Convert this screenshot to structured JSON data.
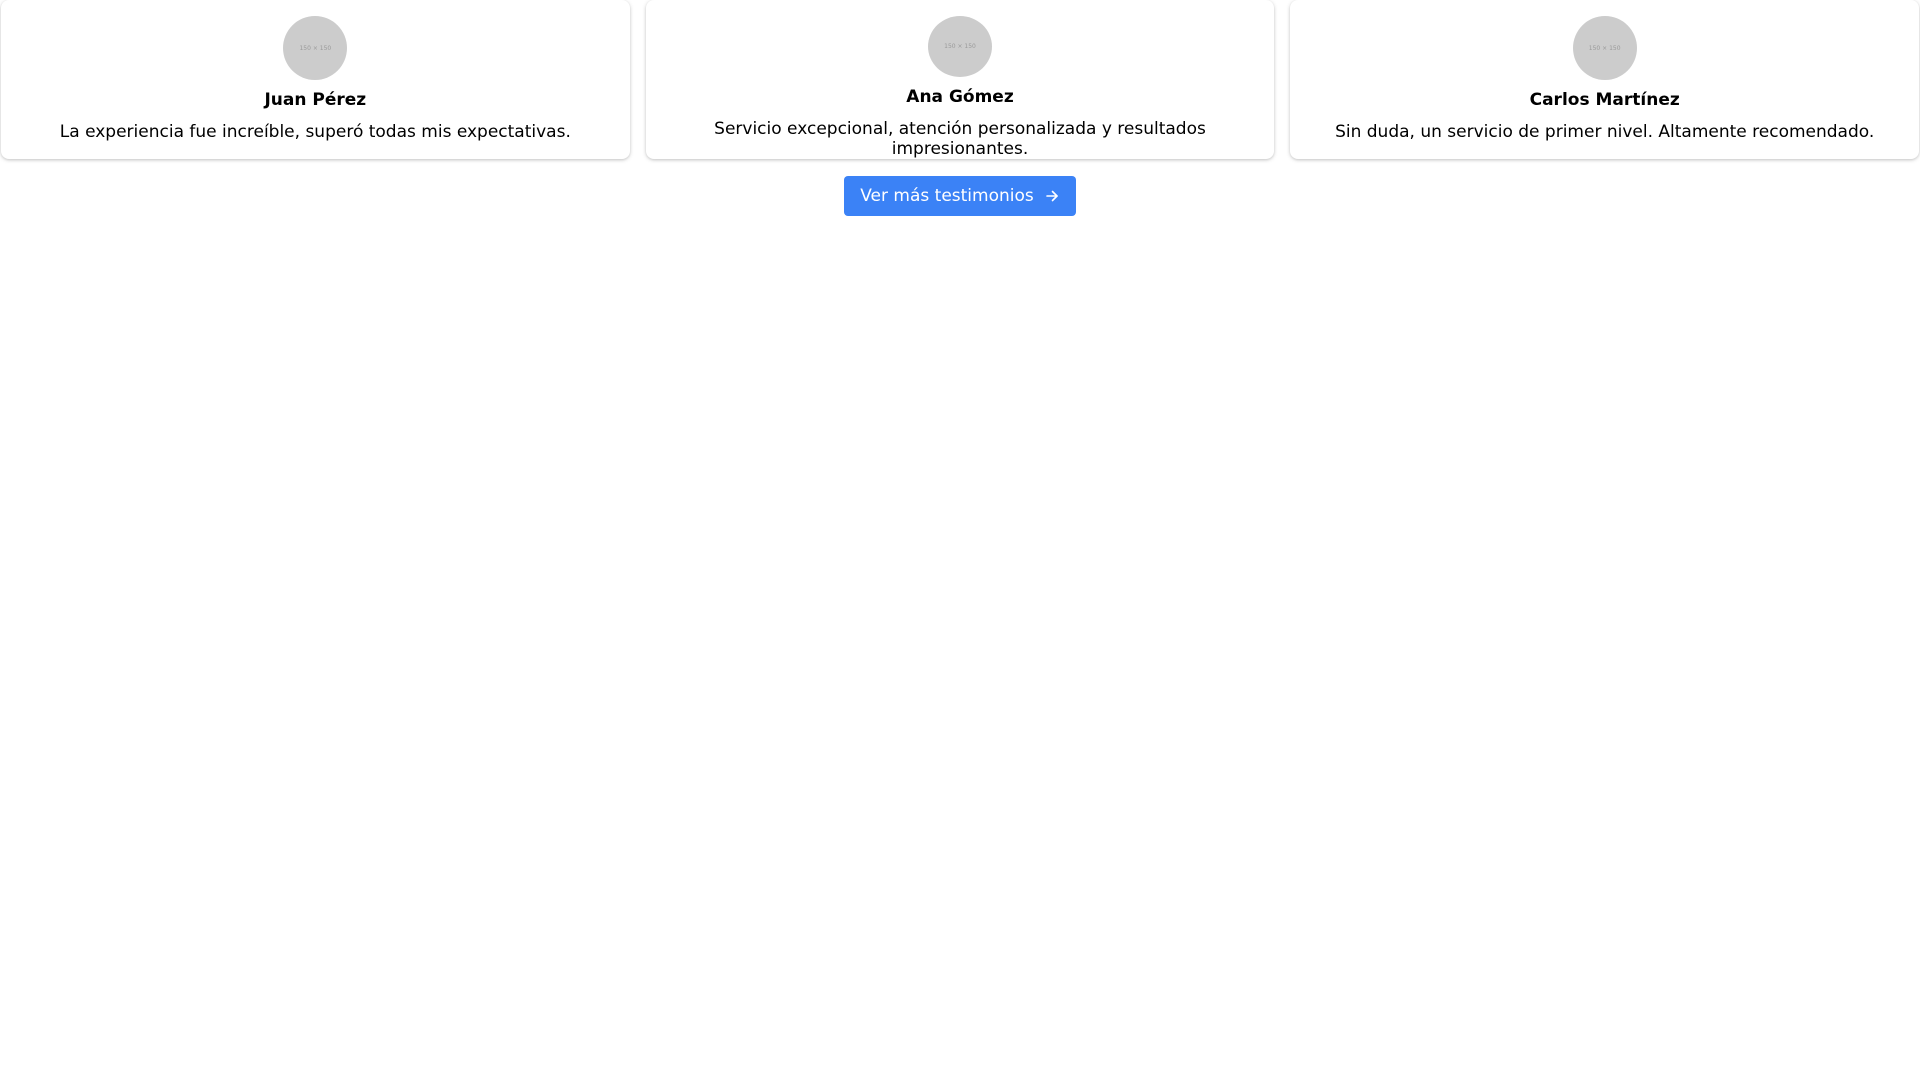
{
  "testimonials": [
    {
      "avatar_text": "150 × 150",
      "name": "Juan Pérez",
      "quote": "La experiencia fue increíble, superó todas mis expectativas."
    },
    {
      "avatar_text": "150 × 150",
      "name": "Ana Gómez",
      "quote": "Servicio excepcional, atención personalizada y resultados impresionantes."
    },
    {
      "avatar_text": "150 × 150",
      "name": "Carlos Martínez",
      "quote": "Sin duda, un servicio de primer nivel. Altamente recomendado."
    }
  ],
  "more_button": {
    "label": "Ver más testimonios",
    "icon": "arrow-right-icon",
    "color": "#3b82f6"
  }
}
